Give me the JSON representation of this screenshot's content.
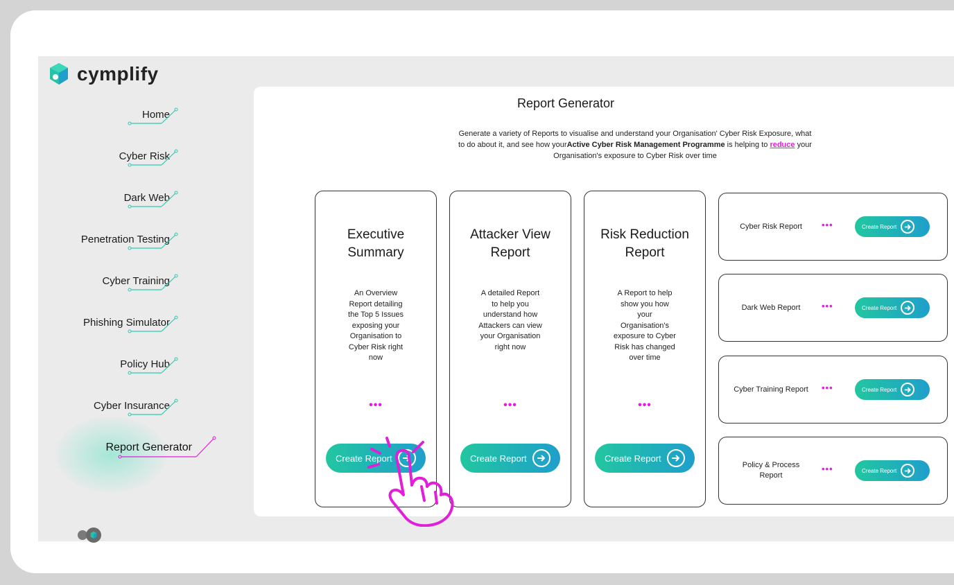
{
  "brand": {
    "name": "cymplify"
  },
  "colors": {
    "accent_teal": "#22c6a0",
    "accent_blue": "#1f9fcc",
    "highlight_magenta": "#e01fd8",
    "nav_line_teal": "#2fc8b0"
  },
  "sidebar": {
    "items": [
      {
        "label": "Home"
      },
      {
        "label": "Cyber Risk"
      },
      {
        "label": "Dark Web"
      },
      {
        "label": "Penetration Testing"
      },
      {
        "label": "Cyber Training"
      },
      {
        "label": "Phishing Simulator"
      },
      {
        "label": "Policy Hub"
      },
      {
        "label": "Cyber Insurance"
      },
      {
        "label": "Report Generator",
        "active": true
      }
    ]
  },
  "main": {
    "title": "Report Generator",
    "desc_part1": "Generate a variety of Reports to visualise and understand your Organisation' Cyber Risk Exposure, what to do about it, and see how your",
    "desc_bold": "Active Cyber Risk Management Programme",
    "desc_part2": " is helping to ",
    "desc_link": "reduce",
    "desc_part3": " your Organisation's exposure to Cyber Risk over time",
    "cards": [
      {
        "title": "Executive Summary",
        "desc": "An Overview Report detailing the Top 5 Issues exposing your Organisation to Cyber Risk right now",
        "dots": "•••",
        "button": "Create Report"
      },
      {
        "title": "Attacker View Report",
        "desc": "A detailed Report to help you understand how Attackers can view your Organisation right now",
        "dots": "•••",
        "button": "Create Report"
      },
      {
        "title": "Risk Reduction Report",
        "desc": "A Report to help show you how your Organisation's exposure to Cyber Risk has changed over time",
        "dots": "•••",
        "button": "Create Report"
      }
    ],
    "small_cards": [
      {
        "title": "Cyber Risk Report",
        "dots": "•••",
        "button": "Create Report"
      },
      {
        "title": "Dark Web Report",
        "dots": "•••",
        "button": "Create Report"
      },
      {
        "title": "Cyber Training Report",
        "dots": "•••",
        "button": "Create Report"
      },
      {
        "title": "Policy & Process Report",
        "dots": "•••",
        "button": "Create Report"
      }
    ]
  },
  "icons": {
    "logo": "cymplify-logo-icon",
    "arrow": "arrow-right-circle-icon",
    "hand": "pointing-hand-click-icon"
  }
}
